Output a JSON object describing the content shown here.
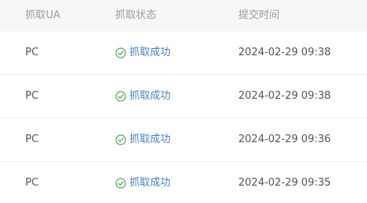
{
  "table": {
    "columns": {
      "ua": "抓取UA",
      "status": "抓取状态",
      "time": "提交时间"
    },
    "rows": [
      {
        "ua": "PC",
        "status": "抓取成功",
        "time": "2024-02-29 09:38"
      },
      {
        "ua": "PC",
        "status": "抓取成功",
        "time": "2024-02-29 09:38"
      },
      {
        "ua": "PC",
        "status": "抓取成功",
        "time": "2024-02-29 09:36"
      },
      {
        "ua": "PC",
        "status": "抓取成功",
        "time": "2024-02-29 09:35"
      }
    ]
  },
  "colors": {
    "success": "#52a45a",
    "link": "#4a7fc0"
  },
  "icons": {
    "status": "check-circle-icon"
  }
}
